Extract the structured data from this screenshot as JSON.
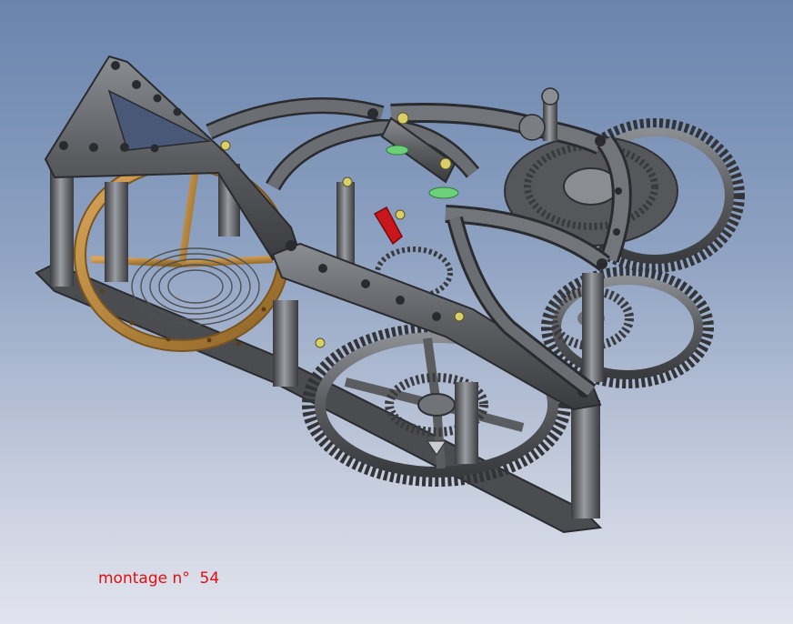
{
  "caption": "montage n°  54",
  "colors": {
    "background_top": "#6a84ad",
    "background_bottom": "#e2e5ee",
    "metal": "#5a5c60",
    "metal_dark": "#2f3033",
    "metal_light": "#8c8f94",
    "brass": "#b5843a",
    "screw": "#d8cf6a",
    "jewel_green": "#6ccf7a",
    "pallet_red": "#c8161a",
    "caption": "#e01010"
  },
  "icons": [
    "movement-render",
    "gear-train",
    "balance-wheel",
    "bridge-plate"
  ]
}
